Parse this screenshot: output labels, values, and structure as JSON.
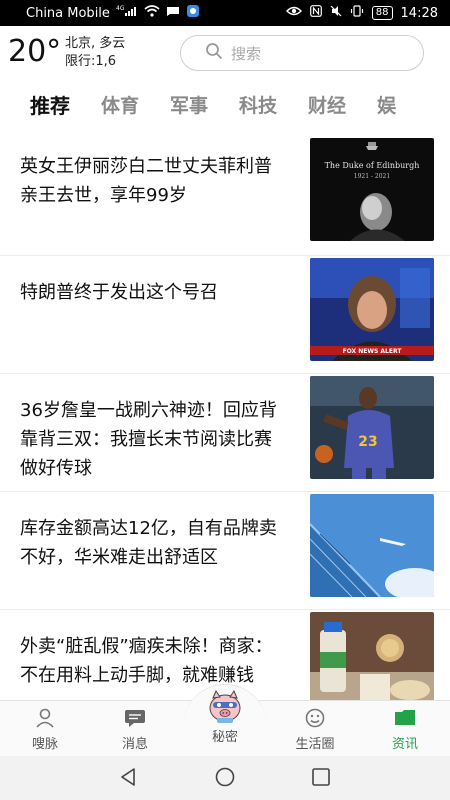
{
  "status_bar": {
    "carrier": "China Mobile",
    "network": "4G",
    "battery": "88",
    "time": "14:28"
  },
  "header": {
    "temperature": "20°",
    "weather_line1": "北京, 多云",
    "weather_line2": "限行:1,6",
    "search_placeholder": "搜索"
  },
  "tabs": [
    "推荐",
    "体育",
    "军事",
    "科技",
    "财经",
    "娱"
  ],
  "news": [
    {
      "title": "英女王伊丽莎白二世丈夫菲利普亲王去世，享年99岁",
      "thumb_caption_1": "The Duke of Edinburgh",
      "thumb_caption_2": "1921 - 2021"
    },
    {
      "title": "特朗普终于发出这个号召",
      "thumb_caption_1": "FOX NEWS ALERT"
    },
    {
      "title": "36岁詹皇一战刷六神迹！回应背靠背三双：我擅长末节阅读比赛做好传球",
      "thumb_caption_1": "23"
    },
    {
      "title": "库存金额高达12亿，自有品牌卖不好，华米难走出舒适区"
    },
    {
      "title": "外卖“脏乱假”痼疾未除！商家：不在用料上动手脚，就难赚钱"
    }
  ],
  "bottom_nav": {
    "items": [
      "嗖脉",
      "消息",
      "秘密",
      "生活圈",
      "资讯"
    ],
    "active": "资讯"
  },
  "colors": {
    "accent": "#22a34a",
    "tab_inactive": "#8a8a8a"
  }
}
